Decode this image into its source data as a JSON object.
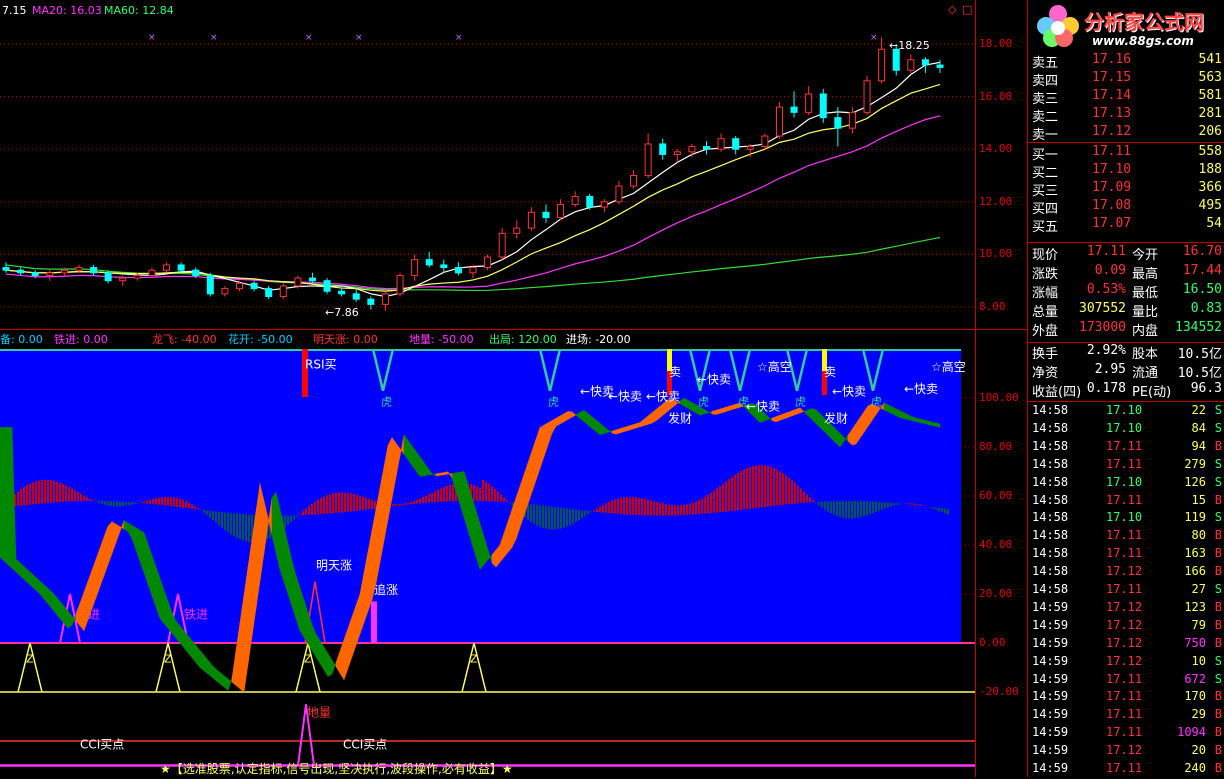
{
  "main_chart": {
    "ma_header": [
      {
        "label": "7.15",
        "color": "#ffffff"
      },
      {
        "label": "MA20: 16.03",
        "color": "#ff33ff"
      },
      {
        "label": "MA60: 12.84",
        "color": "#33ff66"
      }
    ],
    "price_axis": [
      "18.00",
      "16.00",
      "14.00",
      "12.00",
      "10.00",
      "8.00"
    ],
    "annot_high": "18.25",
    "annot_low": "7.86",
    "candles": [
      [
        9.5,
        9.7,
        9.3,
        9.4
      ],
      [
        9.4,
        9.5,
        9.2,
        9.3
      ],
      [
        9.3,
        9.4,
        9.1,
        9.2
      ],
      [
        9.2,
        9.4,
        9.0,
        9.3
      ],
      [
        9.3,
        9.5,
        9.2,
        9.4
      ],
      [
        9.4,
        9.6,
        9.3,
        9.5
      ],
      [
        9.5,
        9.6,
        9.2,
        9.3
      ],
      [
        9.3,
        9.4,
        8.9,
        9.0
      ],
      [
        9.0,
        9.2,
        8.8,
        9.1
      ],
      [
        9.1,
        9.3,
        9.0,
        9.2
      ],
      [
        9.2,
        9.5,
        9.1,
        9.4
      ],
      [
        9.4,
        9.7,
        9.3,
        9.6
      ],
      [
        9.6,
        9.7,
        9.3,
        9.4
      ],
      [
        9.4,
        9.5,
        9.1,
        9.2
      ],
      [
        9.2,
        9.3,
        8.4,
        8.5
      ],
      [
        8.5,
        8.8,
        8.4,
        8.7
      ],
      [
        8.7,
        9.0,
        8.6,
        8.9
      ],
      [
        8.9,
        9.0,
        8.6,
        8.7
      ],
      [
        8.7,
        8.8,
        8.3,
        8.4
      ],
      [
        8.4,
        8.9,
        8.3,
        8.8
      ],
      [
        8.8,
        9.2,
        8.7,
        9.1
      ],
      [
        9.1,
        9.3,
        8.9,
        9.0
      ],
      [
        9.0,
        9.1,
        8.5,
        8.6
      ],
      [
        8.6,
        8.8,
        8.4,
        8.5
      ],
      [
        8.5,
        8.7,
        8.2,
        8.3
      ],
      [
        8.3,
        8.4,
        7.9,
        8.1
      ],
      [
        8.1,
        8.6,
        7.86,
        8.5
      ],
      [
        8.5,
        9.3,
        8.4,
        9.2
      ],
      [
        9.2,
        10.0,
        9.0,
        9.8
      ],
      [
        9.8,
        10.1,
        9.5,
        9.6
      ],
      [
        9.6,
        9.8,
        9.3,
        9.5
      ],
      [
        9.5,
        9.7,
        9.2,
        9.3
      ],
      [
        9.3,
        9.6,
        9.1,
        9.5
      ],
      [
        9.5,
        10.0,
        9.4,
        9.9
      ],
      [
        9.9,
        11.0,
        9.8,
        10.8
      ],
      [
        10.8,
        11.3,
        10.6,
        11.0
      ],
      [
        11.0,
        11.8,
        10.9,
        11.6
      ],
      [
        11.6,
        11.9,
        11.2,
        11.4
      ],
      [
        11.4,
        12.1,
        11.3,
        11.9
      ],
      [
        11.9,
        12.4,
        11.8,
        12.2
      ],
      [
        12.2,
        12.3,
        11.7,
        11.8
      ],
      [
        11.8,
        12.1,
        11.6,
        12.0
      ],
      [
        12.0,
        12.8,
        11.9,
        12.6
      ],
      [
        12.6,
        13.2,
        12.5,
        13.0
      ],
      [
        13.0,
        14.6,
        12.9,
        14.2
      ],
      [
        14.2,
        14.4,
        13.6,
        13.8
      ],
      [
        13.8,
        14.0,
        13.5,
        13.9
      ],
      [
        13.9,
        14.2,
        13.7,
        14.1
      ],
      [
        14.1,
        14.3,
        13.8,
        14.0
      ],
      [
        14.0,
        14.6,
        13.9,
        14.4
      ],
      [
        14.4,
        14.5,
        13.8,
        14.0
      ],
      [
        14.0,
        14.2,
        13.7,
        14.1
      ],
      [
        14.1,
        14.6,
        14.0,
        14.5
      ],
      [
        14.5,
        15.8,
        14.4,
        15.6
      ],
      [
        15.6,
        16.2,
        15.2,
        15.4
      ],
      [
        15.4,
        16.4,
        15.3,
        16.1
      ],
      [
        16.1,
        16.3,
        15.0,
        15.2
      ],
      [
        15.2,
        15.6,
        14.1,
        14.8
      ],
      [
        14.8,
        15.6,
        14.6,
        15.4
      ],
      [
        15.4,
        16.8,
        15.3,
        16.6
      ],
      [
        16.6,
        18.25,
        16.5,
        17.8
      ],
      [
        17.8,
        18.0,
        16.8,
        17.0
      ],
      [
        17.0,
        17.6,
        16.9,
        17.4
      ],
      [
        17.4,
        17.5,
        16.9,
        17.2
      ],
      [
        17.2,
        17.4,
        16.9,
        17.11
      ]
    ]
  },
  "indicator_header": [
    {
      "label": "备: 0.00",
      "color": "#00ccff"
    },
    {
      "label": "铁进: 0.00",
      "color": "#ff33ff"
    },
    {
      "label": "龙飞: -40.00",
      "color": "#ff3333"
    },
    {
      "label": "花开: -50.00",
      "color": "#00ccff"
    },
    {
      "label": "明天涨: 0.00",
      "color": "#ff3333"
    },
    {
      "label": "地量: -50.00",
      "color": "#ff33ff"
    },
    {
      "label": "出局: 120.00",
      "color": "#33ff66"
    },
    {
      "label": "进场: -20.00",
      "color": "#ffffff"
    }
  ],
  "indicator_axis": [
    "100.00",
    "80.00",
    "60.00",
    "40.00",
    "20.00",
    "0.00",
    "-20.00"
  ],
  "indicator_labels": {
    "rsi_buy": "RSI买",
    "quick_sell": "←快卖",
    "fa_cai": "发财",
    "gao_kong": "☆高空",
    "tian_zhang": "明天涨",
    "zhui_zhang": "追涨",
    "tie_jin": "铁进",
    "di_liang": "地量",
    "cci_buy": "CCI买点",
    "z": "Z",
    "hu": "虎",
    "sell_short": "卖"
  },
  "slogan": "★【选准股票,认定指标,信号出现,坚决执行,波段操作,必有收益】★",
  "brand": {
    "name": "分析家公式网",
    "url": "www.88gs.com"
  },
  "order_book": [
    {
      "label": "卖五",
      "price": "17.16",
      "vol": "541"
    },
    {
      "label": "卖四",
      "price": "17.15",
      "vol": "563"
    },
    {
      "label": "卖三",
      "price": "17.14",
      "vol": "581"
    },
    {
      "label": "卖二",
      "price": "17.13",
      "vol": "281"
    },
    {
      "label": "卖一",
      "price": "17.12",
      "vol": "206"
    },
    {
      "label": "买一",
      "price": "17.11",
      "vol": "558"
    },
    {
      "label": "买二",
      "price": "17.10",
      "vol": "188"
    },
    {
      "label": "买三",
      "price": "17.09",
      "vol": "366"
    },
    {
      "label": "买四",
      "price": "17.08",
      "vol": "495"
    },
    {
      "label": "买五",
      "price": "17.07",
      "vol": "54"
    }
  ],
  "stats": [
    {
      "k1": "现价",
      "v1": "17.11",
      "k2": "今开",
      "v2": "16.70",
      "c1": "#ff3333",
      "c2": "#ff3333"
    },
    {
      "k1": "涨跌",
      "v1": "0.09",
      "k2": "最高",
      "v2": "17.44",
      "c1": "#ff3333",
      "c2": "#ff3333"
    },
    {
      "k1": "涨幅",
      "v1": "0.53%",
      "k2": "最低",
      "v2": "16.50",
      "c1": "#ff3333",
      "c2": "#33ff66"
    },
    {
      "k1": "总量",
      "v1": "307552",
      "k2": "量比",
      "v2": "0.83",
      "c1": "#ffff66",
      "c2": "#33ff66"
    },
    {
      "k1": "外盘",
      "v1": "173000",
      "k2": "内盘",
      "v2": "134552",
      "c1": "#ff3333",
      "c2": "#33ff66"
    },
    {
      "k1": "换手",
      "v1": "2.92%",
      "k2": "股本",
      "v2": "10.5亿",
      "c1": "#ffffff",
      "c2": "#ffffff"
    },
    {
      "k1": "净资",
      "v1": "2.95",
      "k2": "流通",
      "v2": "10.5亿",
      "c1": "#ffffff",
      "c2": "#ffffff"
    },
    {
      "k1": "收益(四)",
      "v1": "0.178",
      "k2": "PE(动)",
      "v2": "96.3",
      "c1": "#ffffff",
      "c2": "#ffffff"
    }
  ],
  "ticks": [
    {
      "t": "14:58",
      "p": "17.10",
      "v": "22",
      "s": "S"
    },
    {
      "t": "14:58",
      "p": "17.10",
      "v": "84",
      "s": "S"
    },
    {
      "t": "14:58",
      "p": "17.11",
      "v": "94",
      "s": "B"
    },
    {
      "t": "14:58",
      "p": "17.11",
      "v": "279",
      "s": "S"
    },
    {
      "t": "14:58",
      "p": "17.10",
      "v": "126",
      "s": "S"
    },
    {
      "t": "14:58",
      "p": "17.11",
      "v": "15",
      "s": "B"
    },
    {
      "t": "14:58",
      "p": "17.10",
      "v": "119",
      "s": "S"
    },
    {
      "t": "14:58",
      "p": "17.11",
      "v": "80",
      "s": "B"
    },
    {
      "t": "14:58",
      "p": "17.11",
      "v": "163",
      "s": "B"
    },
    {
      "t": "14:58",
      "p": "17.12",
      "v": "166",
      "s": "B"
    },
    {
      "t": "14:58",
      "p": "17.11",
      "v": "27",
      "s": "S"
    },
    {
      "t": "14:59",
      "p": "17.12",
      "v": "123",
      "s": "B"
    },
    {
      "t": "14:59",
      "p": "17.12",
      "v": "79",
      "s": "B"
    },
    {
      "t": "14:59",
      "p": "17.12",
      "v": "750",
      "s": "B"
    },
    {
      "t": "14:59",
      "p": "17.12",
      "v": "10",
      "s": "S"
    },
    {
      "t": "14:59",
      "p": "17.11",
      "v": "672",
      "s": "S"
    },
    {
      "t": "14:59",
      "p": "17.11",
      "v": "170",
      "s": "B"
    },
    {
      "t": "14:59",
      "p": "17.11",
      "v": "29",
      "s": "B"
    },
    {
      "t": "14:59",
      "p": "17.11",
      "v": "1094",
      "s": "B"
    },
    {
      "t": "14:59",
      "p": "17.12",
      "v": "20",
      "s": "B"
    },
    {
      "t": "14:59",
      "p": "17.11",
      "v": "240",
      "s": "B"
    }
  ],
  "colors": {
    "up": "#ff3333",
    "down": "#00ffff",
    "axis": "#c00000",
    "blue_panel": "#0000ff"
  }
}
